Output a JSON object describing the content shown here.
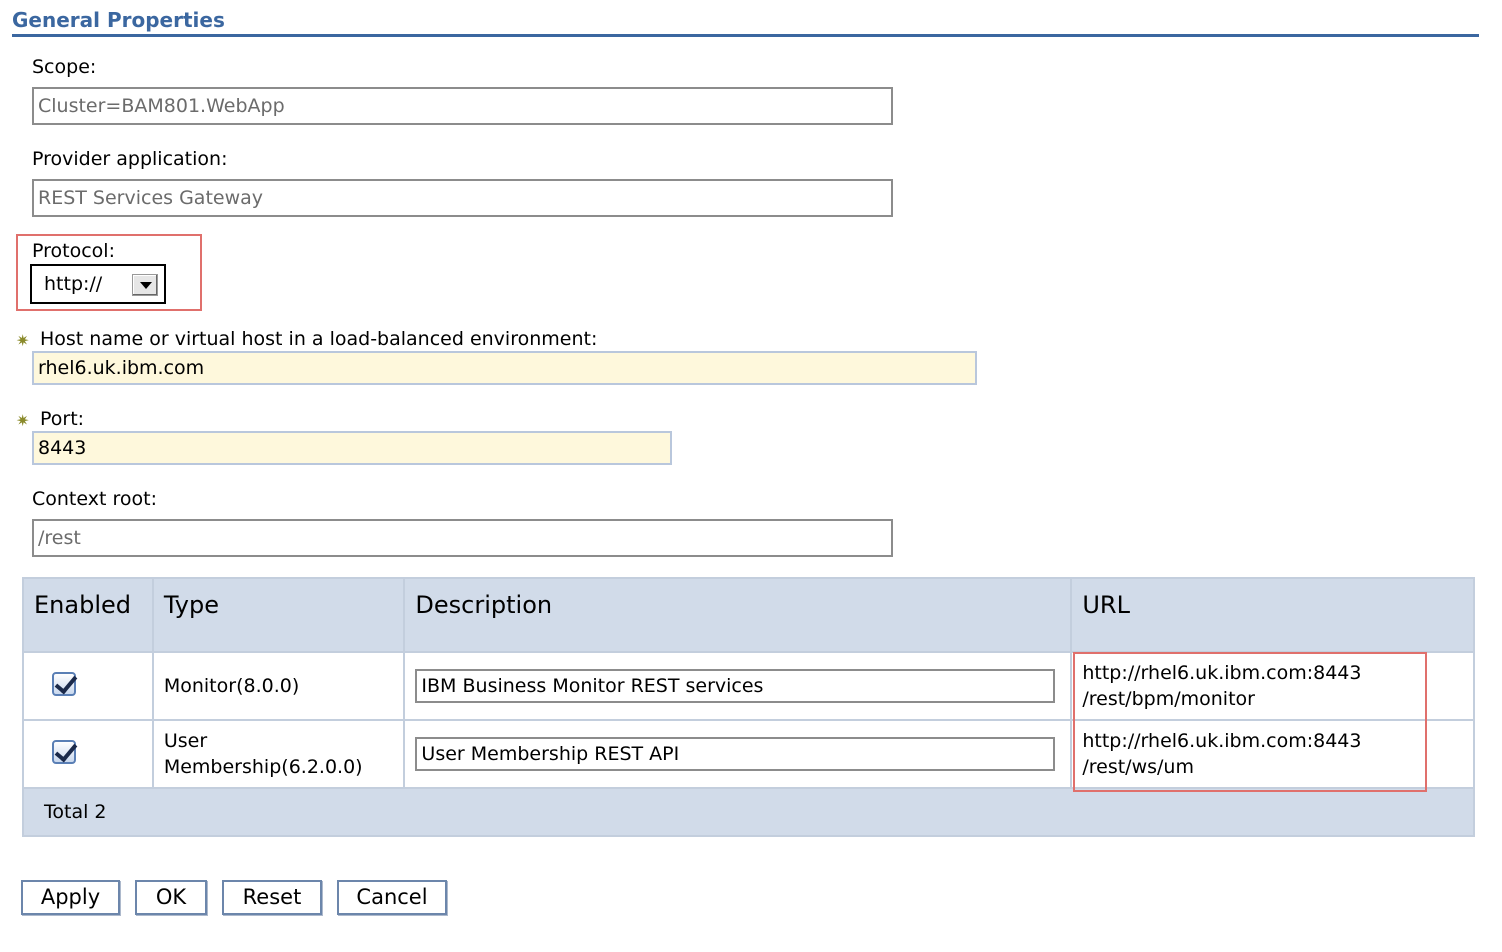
{
  "section": {
    "title": "General Properties"
  },
  "scope": {
    "label": "Scope:",
    "value": "Cluster=BAM801.WebApp"
  },
  "provider": {
    "label": "Provider application:",
    "value": "REST Services Gateway"
  },
  "protocol": {
    "label": "Protocol:",
    "selected": "http://"
  },
  "host": {
    "required_mark": "✷",
    "label": "Host name or virtual host in a load-balanced environment:",
    "value": "rhel6.uk.ibm.com"
  },
  "port": {
    "required_mark": "✷",
    "label": "Port:",
    "value": "8443"
  },
  "context": {
    "label": "Context root:",
    "value": "/rest"
  },
  "table": {
    "headers": [
      "Enabled",
      "Type",
      "Description",
      "URL"
    ],
    "rows": [
      {
        "enabled": true,
        "type": "Monitor(8.0.0)",
        "description": "IBM Business Monitor REST services",
        "url_line1": "http://rhel6.uk.ibm.com:8443",
        "url_line2": "/rest/bpm/monitor"
      },
      {
        "enabled": true,
        "type_line1": "User",
        "type_line2": "Membership(6.2.0.0)",
        "description": "User Membership REST API",
        "url_line1": "http://rhel6.uk.ibm.com:8443",
        "url_line2": "/rest/ws/um"
      }
    ],
    "total": "Total 2"
  },
  "buttons": {
    "apply": "Apply",
    "ok": "OK",
    "reset": "Reset",
    "cancel": "Cancel"
  },
  "colors": {
    "title": "#3b67a0",
    "header_bg": "#d1dbe9",
    "required_bg": "#fef8dc",
    "highlight": "#e0706c"
  }
}
